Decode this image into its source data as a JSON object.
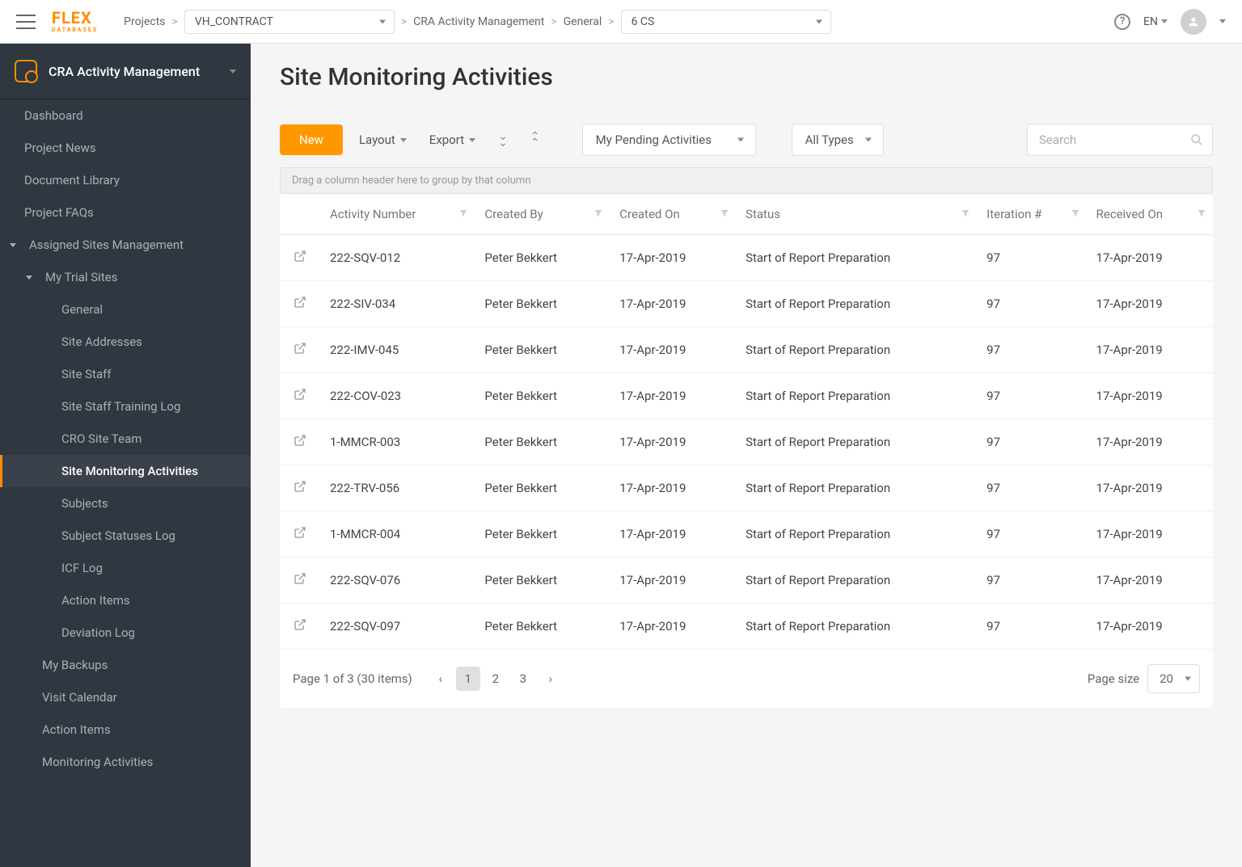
{
  "topbar": {
    "projects_label": "Projects",
    "project_select": "VH_CONTRACT",
    "bc_activity": "CRA Activity Management",
    "bc_general": "General",
    "site_select": "6 CS",
    "lang": "EN"
  },
  "sidebar": {
    "title": "CRA Activity Management",
    "items": [
      {
        "label": "Dashboard"
      },
      {
        "label": "Project News"
      },
      {
        "label": "Document Library"
      },
      {
        "label": "Project FAQs"
      },
      {
        "label": "Assigned Sites Management",
        "arrow": true
      }
    ],
    "my_trial_sites": "My Trial Sites",
    "sub_items": [
      {
        "label": "General"
      },
      {
        "label": "Site Addresses"
      },
      {
        "label": "Site Staff"
      },
      {
        "label": "Site Staff Training Log"
      },
      {
        "label": "CRO Site Team"
      },
      {
        "label": "Site Monitoring Activities",
        "active": true
      },
      {
        "label": "Subjects"
      },
      {
        "label": "Subject Statuses Log"
      },
      {
        "label": "ICF Log"
      },
      {
        "label": "Action Items"
      },
      {
        "label": "Deviation Log"
      }
    ],
    "bottom_items": [
      {
        "label": "My Backups"
      },
      {
        "label": "Visit Calendar"
      },
      {
        "label": "Action Items"
      },
      {
        "label": "Monitoring Activities"
      }
    ]
  },
  "main": {
    "title": "Site Monitoring Activities"
  },
  "toolbar": {
    "new_label": "New",
    "layout_label": "Layout",
    "export_label": "Export",
    "pending_filter": "My Pending Activities",
    "types_filter": "All Types",
    "search_placeholder": "Search"
  },
  "group_hint": "Drag a column header here to group by that column",
  "columns": [
    "Activity Number",
    "Created By",
    "Created On",
    "Status",
    "Iteration #",
    "Received On"
  ],
  "rows": [
    {
      "num": "222-SQV-012",
      "by": "Peter Bekkert",
      "on": "17-Apr-2019",
      "status": "Start of Report Preparation",
      "iter": "97",
      "recv": "17-Apr-2019"
    },
    {
      "num": "222-SIV-034",
      "by": "Peter Bekkert",
      "on": "17-Apr-2019",
      "status": "Start of Report Preparation",
      "iter": "97",
      "recv": "17-Apr-2019"
    },
    {
      "num": "222-IMV-045",
      "by": "Peter Bekkert",
      "on": "17-Apr-2019",
      "status": "Start of Report Preparation",
      "iter": "97",
      "recv": "17-Apr-2019"
    },
    {
      "num": "222-COV-023",
      "by": "Peter Bekkert",
      "on": "17-Apr-2019",
      "status": "Start of Report Preparation",
      "iter": "97",
      "recv": "17-Apr-2019"
    },
    {
      "num": "1-MMCR-003",
      "by": "Peter Bekkert",
      "on": "17-Apr-2019",
      "status": "Start of Report Preparation",
      "iter": "97",
      "recv": "17-Apr-2019"
    },
    {
      "num": "222-TRV-056",
      "by": "Peter Bekkert",
      "on": "17-Apr-2019",
      "status": "Start of Report Preparation",
      "iter": "97",
      "recv": "17-Apr-2019"
    },
    {
      "num": "1-MMCR-004",
      "by": "Peter Bekkert",
      "on": "17-Apr-2019",
      "status": "Start of Report Preparation",
      "iter": "97",
      "recv": "17-Apr-2019"
    },
    {
      "num": "222-SQV-076",
      "by": "Peter Bekkert",
      "on": "17-Apr-2019",
      "status": "Start of Report Preparation",
      "iter": "97",
      "recv": "17-Apr-2019"
    },
    {
      "num": "222-SQV-097",
      "by": "Peter Bekkert",
      "on": "17-Apr-2019",
      "status": "Start of Report Preparation",
      "iter": "97",
      "recv": "17-Apr-2019"
    }
  ],
  "pagination": {
    "summary": "Page 1 of  3  (30 items)",
    "pages": [
      "1",
      "2",
      "3"
    ],
    "active_page": "1",
    "page_size_label": "Page size",
    "page_size": "20"
  }
}
